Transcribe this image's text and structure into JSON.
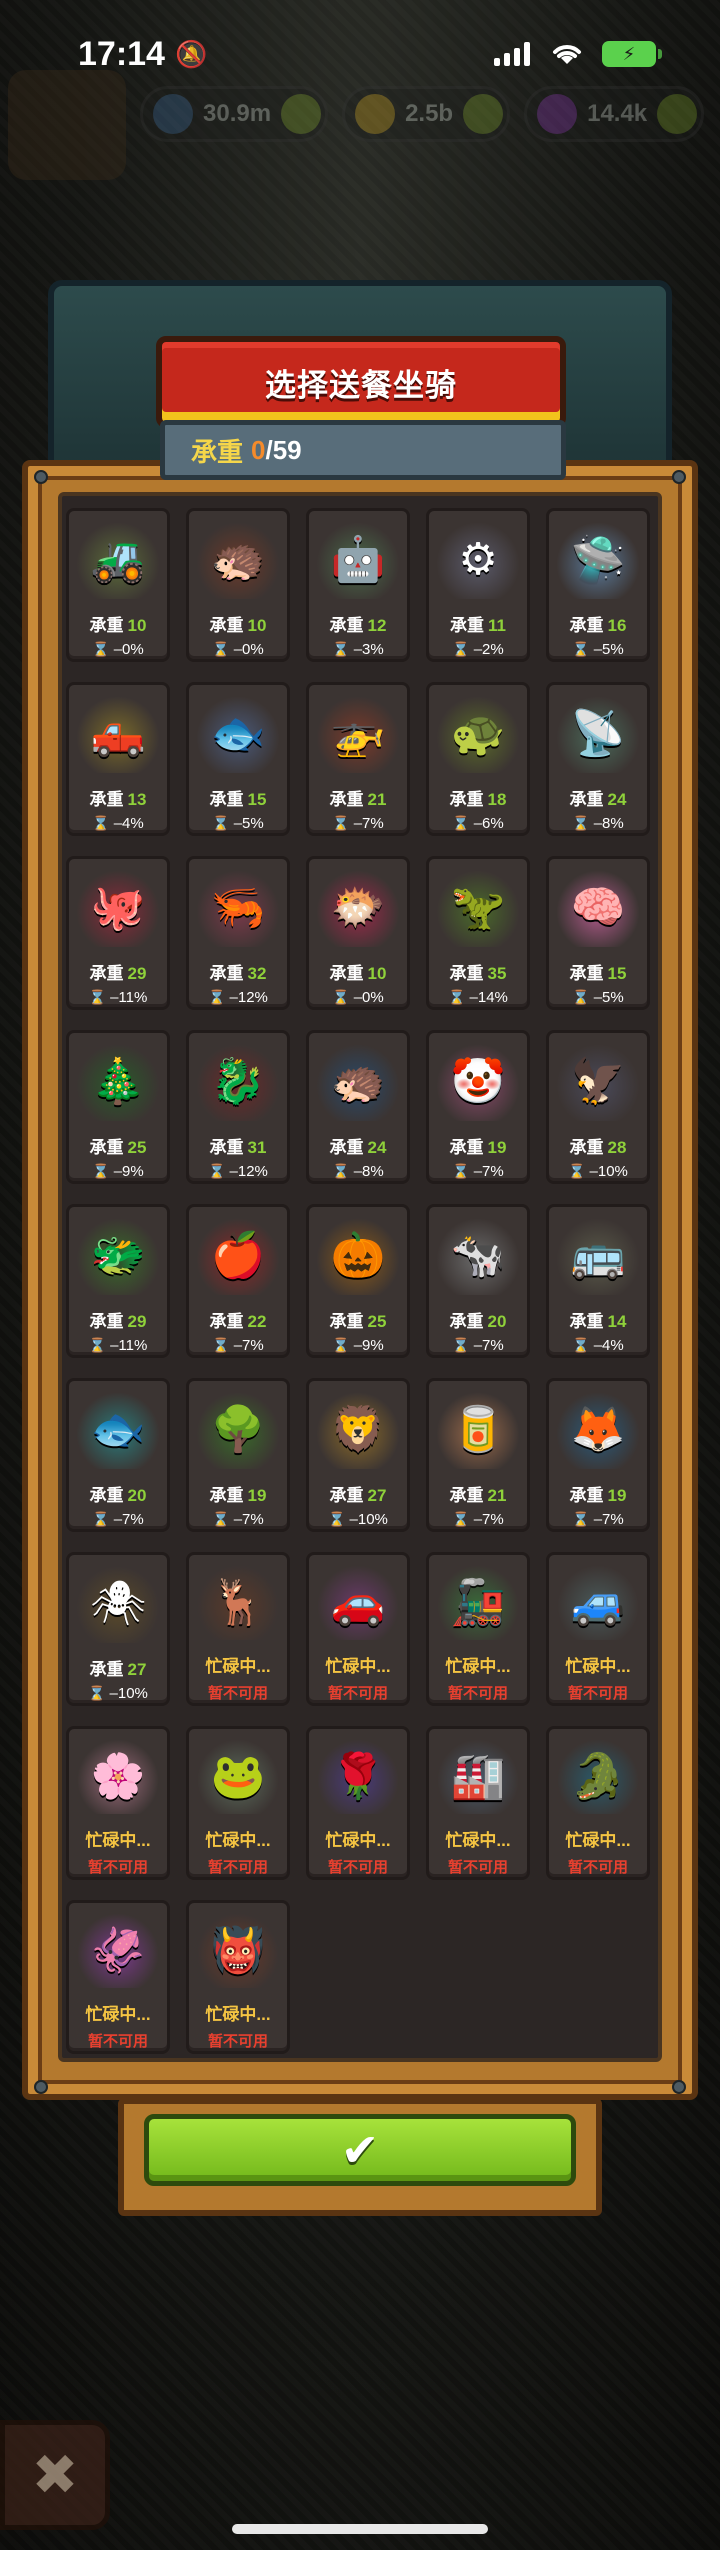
{
  "status_bar": {
    "time": "17:14",
    "bell_icon": "bell-slash-icon"
  },
  "resources": [
    {
      "value": "30.9m",
      "icon": "blue-orb-icon",
      "color": "#3d6a9a"
    },
    {
      "value": "2.5b",
      "icon": "gold-coin-icon",
      "color": "#c9a020"
    },
    {
      "value": "14.4k",
      "icon": "potion-icon",
      "color": "#8a3ab0"
    }
  ],
  "dialog": {
    "title": "选择送餐坐骑",
    "capacity_label": "承重",
    "capacity_current": "0",
    "capacity_total": "/59"
  },
  "card_labels": {
    "capacity": "承重"
  },
  "mounts": [
    {
      "art": "🚜",
      "tint": "#5b6b3a",
      "capacity": "10",
      "time": "–0%"
    },
    {
      "art": "🦔",
      "tint": "#6b3a2a",
      "capacity": "10",
      "time": "–0%"
    },
    {
      "art": "🤖",
      "tint": "#4a6a4a",
      "capacity": "12",
      "time": "–3%"
    },
    {
      "art": "⚙",
      "tint": "#5a5a6a",
      "capacity": "11",
      "time": "–2%"
    },
    {
      "art": "🛸",
      "tint": "#5a7a9a",
      "capacity": "16",
      "time": "–5%"
    },
    {
      "art": "🛻",
      "tint": "#7a6a2a",
      "capacity": "13",
      "time": "–4%"
    },
    {
      "art": "🐟",
      "tint": "#4a5a7a",
      "capacity": "15",
      "time": "–5%"
    },
    {
      "art": "🚁",
      "tint": "#7a3a2a",
      "capacity": "21",
      "time": "–7%"
    },
    {
      "art": "🐢",
      "tint": "#5a6a2a",
      "capacity": "18",
      "time": "–6%"
    },
    {
      "art": "📡",
      "tint": "#4a6a5a",
      "capacity": "24",
      "time": "–8%"
    },
    {
      "art": "🐙",
      "tint": "#8a2a3a",
      "capacity": "29",
      "time": "–11%"
    },
    {
      "art": "🦐",
      "tint": "#7a3a4a",
      "capacity": "32",
      "time": "–12%"
    },
    {
      "art": "🐡",
      "tint": "#9a2a4a",
      "capacity": "10",
      "time": "–0%"
    },
    {
      "art": "🦖",
      "tint": "#4a6a2a",
      "capacity": "35",
      "time": "–14%"
    },
    {
      "art": "🧠",
      "tint": "#b05a8a",
      "capacity": "15",
      "time": "–5%"
    },
    {
      "art": "🎄",
      "tint": "#2a5a2a",
      "capacity": "25",
      "time": "–9%"
    },
    {
      "art": "🐉",
      "tint": "#6a2a2a",
      "capacity": "31",
      "time": "–12%"
    },
    {
      "art": "🦔",
      "tint": "#2a4a6a",
      "capacity": "24",
      "time": "–8%"
    },
    {
      "art": "🤡",
      "tint": "#8a4a6a",
      "capacity": "19",
      "time": "–7%"
    },
    {
      "art": "🦅",
      "tint": "#4a4a5a",
      "capacity": "28",
      "time": "–10%"
    },
    {
      "art": "🐲",
      "tint": "#3a6a2a",
      "capacity": "29",
      "time": "–11%"
    },
    {
      "art": "🍎",
      "tint": "#8a2a2a",
      "capacity": "22",
      "time": "–7%"
    },
    {
      "art": "🎃",
      "tint": "#8a5a1a",
      "capacity": "25",
      "time": "–9%"
    },
    {
      "art": "🐄",
      "tint": "#6a6a6a",
      "capacity": "20",
      "time": "–7%"
    },
    {
      "art": "🚌",
      "tint": "#5a5a4a",
      "capacity": "14",
      "time": "–4%"
    },
    {
      "art": "🐟",
      "tint": "#2a7a7a",
      "capacity": "20",
      "time": "–7%"
    },
    {
      "art": "🌳",
      "tint": "#3a6a2a",
      "capacity": "19",
      "time": "–7%"
    },
    {
      "art": "🦁",
      "tint": "#8a6a2a",
      "capacity": "27",
      "time": "–10%"
    },
    {
      "art": "🥫",
      "tint": "#9a6a4a",
      "capacity": "21",
      "time": "–7%"
    },
    {
      "art": "🦊",
      "tint": "#2a5a7a",
      "capacity": "19",
      "time": "–7%"
    },
    {
      "art": "🕷",
      "tint": "#5a4a2a",
      "capacity": "27",
      "time": "–10%"
    },
    {
      "art": "🦌",
      "tint": "#5a3a2a",
      "busy": true,
      "status": "忙碌中...",
      "note": "暂不可用"
    },
    {
      "art": "🚗",
      "tint": "#6a3a6a",
      "busy": true,
      "status": "忙碌中...",
      "note": "暂不可用"
    },
    {
      "art": "🚂",
      "tint": "#3a6a3a",
      "busy": true,
      "status": "忙碌中...",
      "note": "暂不可用"
    },
    {
      "art": "🚙",
      "tint": "#4a5a5a",
      "busy": true,
      "status": "忙碌中...",
      "note": "暂不可用"
    },
    {
      "art": "🌸",
      "tint": "#9a6a7a",
      "busy": true,
      "status": "忙碌中...",
      "note": "暂不可用"
    },
    {
      "art": "🐸",
      "tint": "#5a6a5a",
      "busy": true,
      "status": "忙碌中...",
      "note": "暂不可用"
    },
    {
      "art": "🌹",
      "tint": "#4a3a7a",
      "busy": true,
      "status": "忙碌中...",
      "note": "暂不可用"
    },
    {
      "art": "🏭",
      "tint": "#4a5a6a",
      "busy": true,
      "status": "忙碌中...",
      "note": "暂不可用"
    },
    {
      "art": "🐊",
      "tint": "#2a5a6a",
      "busy": true,
      "status": "忙碌中...",
      "note": "暂不可用"
    },
    {
      "art": "🦑",
      "tint": "#7a3a8a",
      "busy": true,
      "status": "忙碌中...",
      "note": "暂不可用"
    },
    {
      "art": "👹",
      "tint": "#6a3a2a",
      "busy": true,
      "status": "忙碌中...",
      "note": "暂不可用"
    }
  ],
  "confirm_button": {
    "icon": "checkmark-icon",
    "glyph": "✔"
  },
  "close_button": {
    "icon": "close-icon",
    "glyph": "✖"
  }
}
